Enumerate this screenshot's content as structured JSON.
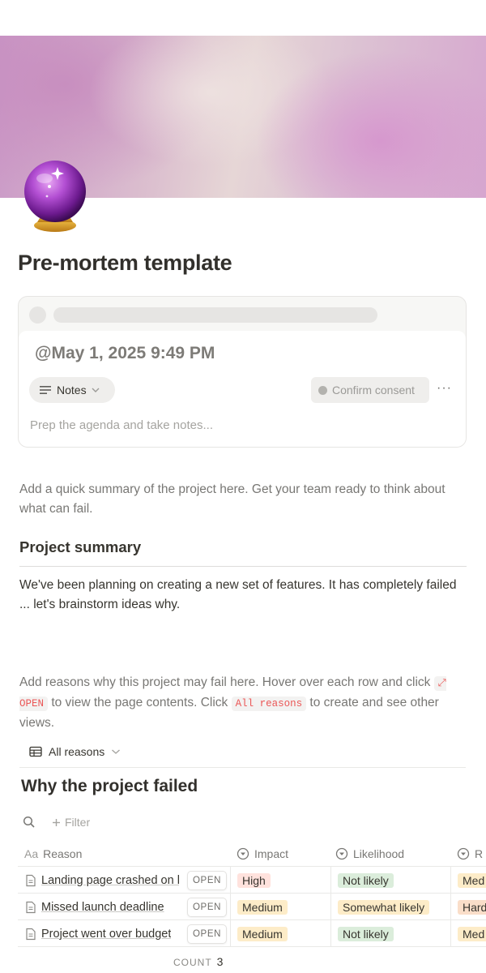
{
  "page": {
    "title": "Pre-mortem template",
    "icon": "crystal-ball-icon"
  },
  "meeting": {
    "date": "@May 1, 2025 9:49 PM",
    "notes_label": "Notes",
    "consent_label": "Confirm consent",
    "more_label": "···",
    "placeholder": "Prep the agenda and take notes..."
  },
  "intro": "Add a quick summary of the project here. Get your team ready to think about what can fail.",
  "summary": {
    "heading": "Project summary",
    "text": "We've been planning on creating a new set of features. It has completely failed ... let's brainstorm ideas why."
  },
  "instructions": {
    "part1": "Add reasons why this project may fail here. Hover over each row and click ",
    "open_code": "⤢ OPEN",
    "part2": " to view the page contents. Click ",
    "reasons_code": "All reasons",
    "part3": " to create and see other views."
  },
  "view": {
    "label": "All reasons"
  },
  "database": {
    "title": "Why the project failed",
    "filter_label": "Filter",
    "open_label": "OPEN",
    "columns": {
      "reason": "Reason",
      "reason_prefix": "Aa",
      "impact": "Impact",
      "likelihood": "Likelihood",
      "extra": "R"
    },
    "rows": [
      {
        "reason": "Landing page crashed on launch",
        "impact": "High",
        "likelihood": "Not likely",
        "extra": "Med"
      },
      {
        "reason": "Missed launch deadline",
        "impact": "Medium",
        "likelihood": "Somewhat likely",
        "extra": "Hard"
      },
      {
        "reason": "Project went over budget",
        "impact": "Medium",
        "likelihood": "Not likely",
        "extra": "Med"
      }
    ],
    "count_label": "COUNT",
    "count_value": "3"
  },
  "colors": {
    "tag_high": "#ffe2dd",
    "tag_medium": "#fdecc8",
    "tag_not_likely": "#dbeddb",
    "tag_somewhat_likely": "#fdecc8",
    "tag_hard": "#fadec9",
    "code_text": "#eb5757"
  }
}
